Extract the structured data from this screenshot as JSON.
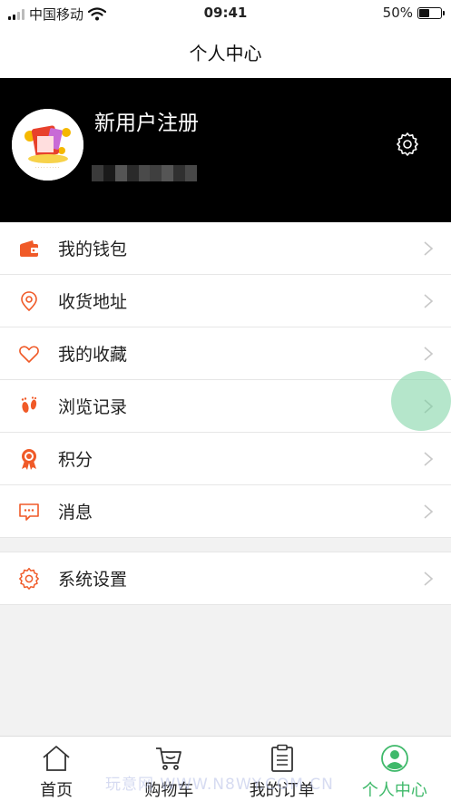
{
  "status_bar": {
    "carrier": "中国移动",
    "time": "09:41",
    "battery": "50%",
    "battery_level": 0.5
  },
  "nav": {
    "title": "个人中心"
  },
  "profile": {
    "username": "新用户注册"
  },
  "menu": [
    {
      "label": "我的钱包",
      "icon": "wallet-icon"
    },
    {
      "label": "收货地址",
      "icon": "location-pin-icon"
    },
    {
      "label": "我的收藏",
      "icon": "heart-icon"
    },
    {
      "label": "浏览记录",
      "icon": "footprints-icon"
    },
    {
      "label": "积分",
      "icon": "medal-icon"
    },
    {
      "label": "消息",
      "icon": "message-icon"
    }
  ],
  "menu2": [
    {
      "label": "系统设置",
      "icon": "gear-icon"
    }
  ],
  "tabbar": [
    {
      "label": "首页",
      "icon": "home-icon"
    },
    {
      "label": "购物车",
      "icon": "cart-icon"
    },
    {
      "label": "我的订单",
      "icon": "order-list-icon"
    },
    {
      "label": "个人中心",
      "icon": "user-circle-icon",
      "active": true
    }
  ],
  "colors": {
    "accent": "#f05a28",
    "tab_active": "#3fb96a",
    "header_bg": "#000000"
  },
  "watermark": "玩意网 WWW.N8WY.COM.CN"
}
